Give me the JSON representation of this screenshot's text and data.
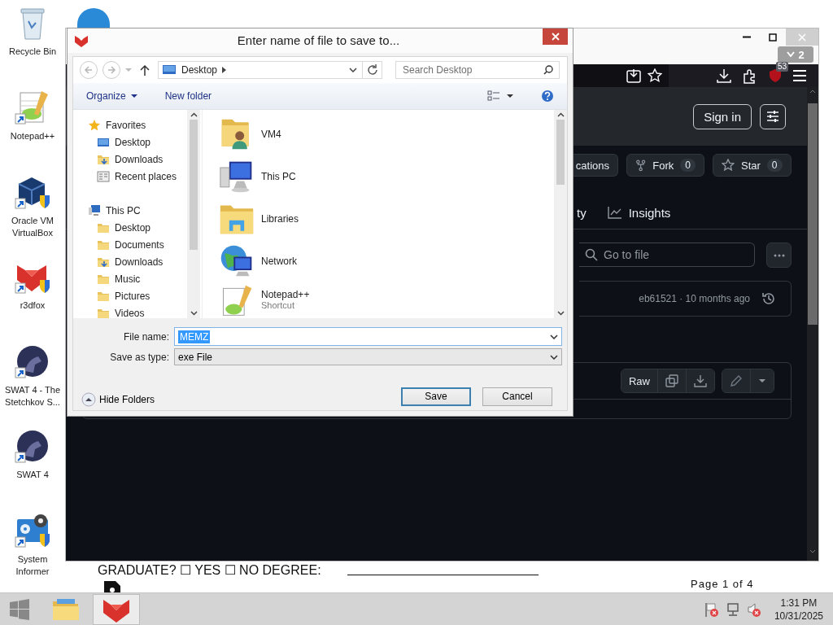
{
  "desktop_icons": [
    {
      "label": "Recycle Bin",
      "kind": "recycle"
    },
    {
      "label": "Notepad++",
      "kind": "notepad"
    },
    {
      "label": "Oracle VM VirtualBox",
      "kind": "virtualbox"
    },
    {
      "label": "r3dfox",
      "kind": "r3dfox"
    },
    {
      "label": "SWAT 4 - The Stetchkov S...",
      "kind": "swat"
    },
    {
      "label": "SWAT 4",
      "kind": "swat"
    },
    {
      "label": "System Informer",
      "kind": "sysinfo"
    }
  ],
  "background_document": {
    "form_line": "GRADUATE? ☐ YES ☐ NO DEGREE:",
    "page_indicator": "Page 1 of 4"
  },
  "browser": {
    "tab_count": "2",
    "extension_badge": "53",
    "sign_in": "Sign in",
    "repo_actions": [
      {
        "label": "cations",
        "kind": "plain"
      },
      {
        "label": "Fork",
        "count": "0",
        "kind": "fork"
      },
      {
        "label": "Star",
        "count": "0",
        "kind": "star"
      }
    ],
    "nav_tabs": [
      {
        "label": "ty",
        "kind": "plain",
        "selected": false
      },
      {
        "label": "Insights",
        "kind": "graph",
        "selected": false
      }
    ],
    "file_search": {
      "placeholder": "Go to file"
    },
    "commit": {
      "text": "eb61521 · 10 months ago"
    },
    "file_actions": {
      "raw": "Raw"
    }
  },
  "dialog": {
    "title": "Enter name of file to save to...",
    "address": {
      "location": "Desktop"
    },
    "search": {
      "placeholder": "Search Desktop"
    },
    "commands": {
      "organize": "Organize",
      "new_folder": "New folder"
    },
    "nav_tree": [
      {
        "label": "Favorites",
        "kind": "star",
        "children": [
          {
            "label": "Desktop",
            "kind": "desktop"
          },
          {
            "label": "Downloads",
            "kind": "downloads"
          },
          {
            "label": "Recent places",
            "kind": "recent"
          }
        ]
      },
      {
        "label": "This PC",
        "kind": "pc",
        "children": [
          {
            "label": "Desktop",
            "kind": "folder"
          },
          {
            "label": "Documents",
            "kind": "folder"
          },
          {
            "label": "Downloads",
            "kind": "downloads"
          },
          {
            "label": "Music",
            "kind": "folder"
          },
          {
            "label": "Pictures",
            "kind": "folder"
          },
          {
            "label": "Videos",
            "kind": "folder"
          }
        ]
      }
    ],
    "items": [
      {
        "name": "VM4",
        "kind": "user"
      },
      {
        "name": "This PC",
        "kind": "pc"
      },
      {
        "name": "Libraries",
        "kind": "libraries"
      },
      {
        "name": "Network",
        "kind": "network"
      },
      {
        "name": "Notepad++",
        "detail": "Shortcut",
        "kind": "notepad"
      }
    ],
    "file_name_label": "File name:",
    "file_name": "MEMZ",
    "type_label": "Save as type:",
    "save_as_type": "exe File",
    "hide_folders": "Hide Folders",
    "buttons": [
      {
        "label": "Save",
        "kind": "default"
      },
      {
        "label": "Cancel",
        "kind": "normal"
      }
    ]
  },
  "taskbar": {
    "apps": [
      {
        "kind": "explorer",
        "selected": false
      },
      {
        "kind": "r3dfox",
        "selected": true
      }
    ],
    "clock": {
      "time": "1:31 PM",
      "date": "10/31/2025"
    }
  }
}
